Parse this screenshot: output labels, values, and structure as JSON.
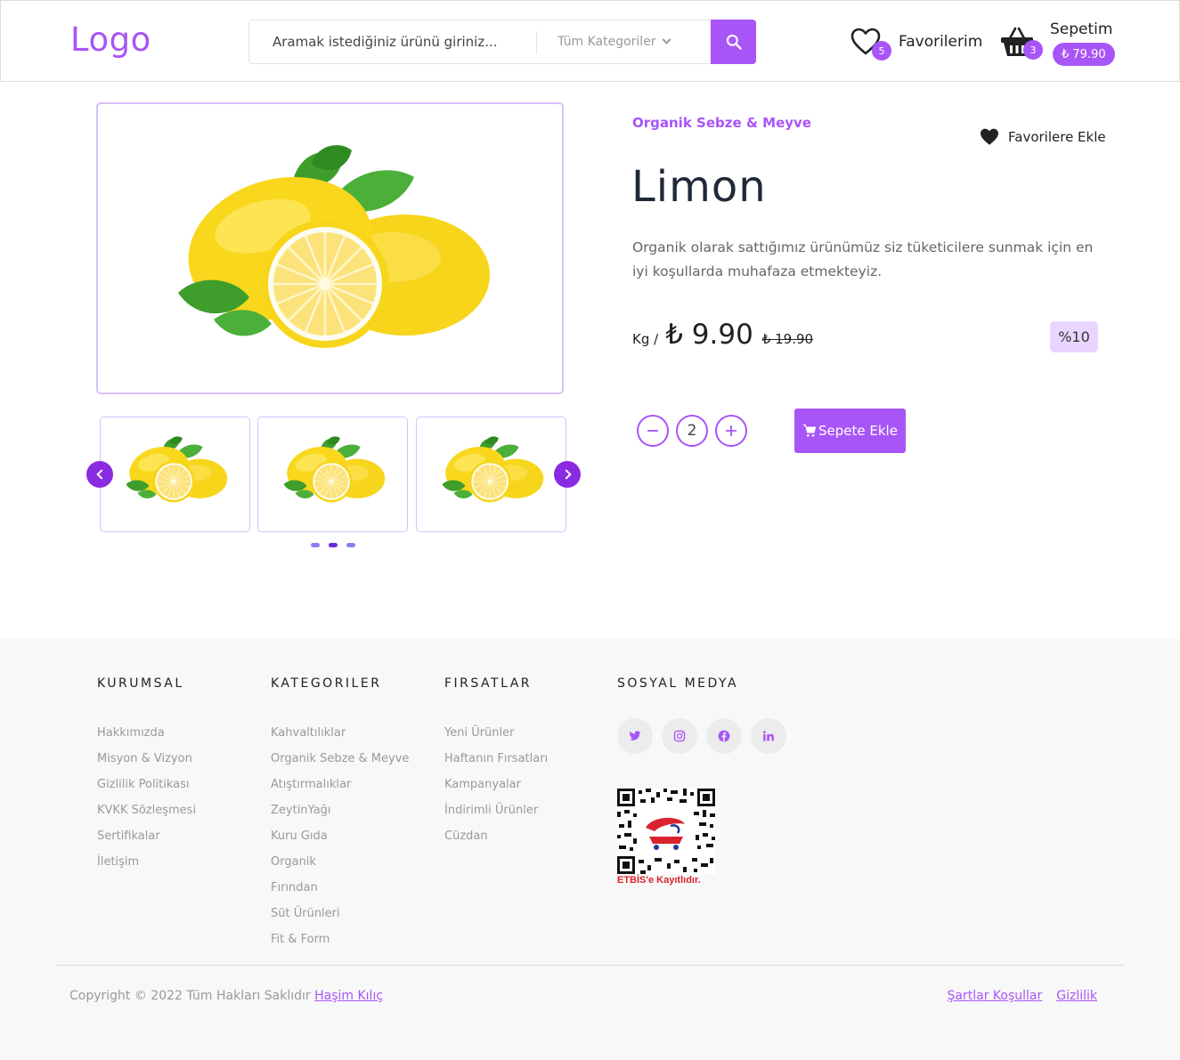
{
  "header": {
    "logo": "Logo",
    "search_placeholder": "Aramak istediğiniz ürünü giriniz...",
    "category_label": "Tüm Kategoriler",
    "favorites_label": "Favorilerim",
    "favorites_count": "5",
    "cart_label": "Sepetim",
    "cart_count": "3",
    "cart_total": "₺ 79.90"
  },
  "product": {
    "category": "Organik Sebze & Meyve",
    "add_favorite_label": "Favorilere Ekle",
    "title": "Limon",
    "description": "Organik olarak sattığımız ürünümüz siz tüketicilere sunmak için en iyi koşullarda muhafaza etmekteyiz.",
    "unit": "Kg /",
    "price": "₺ 9.90",
    "old_price": "₺ 19.90",
    "discount": "%10",
    "quantity": "2",
    "add_to_cart_label": "Sepete Ekle",
    "gallery_active_dot": 2,
    "gallery_dot_count": 3
  },
  "footer": {
    "columns": [
      {
        "title": "KURUMSAL",
        "links": [
          "Hakkımızda",
          "Misyon & Vizyon",
          "Gizlilik Politikası",
          "KVKK Sözleşmesi",
          "Sertifikalar",
          "İletişim"
        ]
      },
      {
        "title": "KATEGORILER",
        "links": [
          "Kahvaltılıklar",
          "Organik Sebze & Meyve",
          "Atıştırmalıklar",
          "ZeytinYağı",
          "Kuru Gıda",
          "Organik",
          "Fırından",
          "Süt Ürünleri",
          "Fit & Form"
        ]
      },
      {
        "title": "FIRSATLAR",
        "links": [
          "Yeni Ürünler",
          "Haftanın Fırsatları",
          "Kampanyalar",
          "İndirimli Ürünler",
          "Cüzdan"
        ]
      },
      {
        "title": "SOSYAL MEDYA",
        "links": []
      }
    ],
    "social_icons": [
      "twitter-icon",
      "instagram-icon",
      "facebook-icon",
      "linkedin-icon"
    ],
    "etbis_text": "ETBİS'e Kayıtlıdır.",
    "copyright_text": "Copyright © 2022 Tüm Hakları Saklıdır",
    "copyright_author": "Haşim Kılıç",
    "terms_label": "Şartlar Koşullar",
    "privacy_label": "Gizlilik"
  },
  "colors": {
    "accent": "#a855f7",
    "arrow": "#8a2be2",
    "discount_bg": "#e9d5ff",
    "footer_bg": "#f8f8f8"
  }
}
